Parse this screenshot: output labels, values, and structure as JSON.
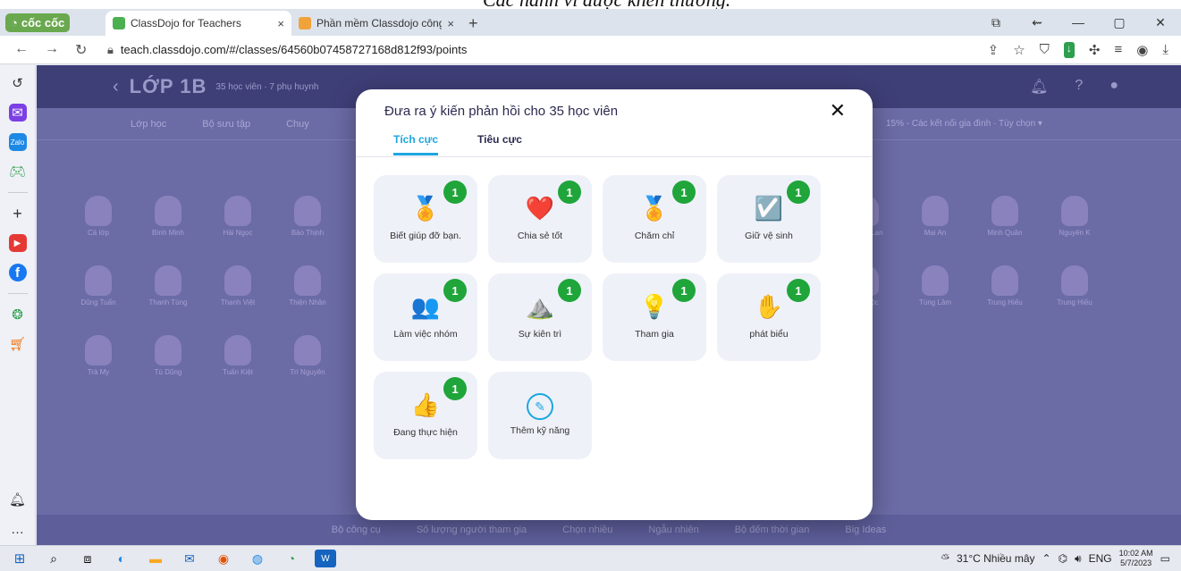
{
  "doc_caption": "Các hành vi được khen thưởng.",
  "browser": {
    "brand": "cốc cốc",
    "tabs": [
      {
        "title": "ClassDojo for Teachers",
        "close": "×"
      },
      {
        "title": "Phần mềm Classdojo công c",
        "close": "×"
      }
    ],
    "new_tab": "+",
    "url": "teach.classdojo.com/#/classes/64560b07458727168d812f93/points"
  },
  "app": {
    "class_name": "LỚP 1B",
    "class_sub": "35 học viên · 7 phụ huynh",
    "nav": [
      "Lớp học",
      "Bộ sưu tập",
      "Chuy"
    ],
    "nav_right": "15% - Các kết nối gia đình · Tùy chọn ▾",
    "students": [
      "Cả lớp",
      "Bình Minh",
      "Hải Ngọc",
      "Bảo Thịnh",
      "",
      "",
      "",
      "",
      "",
      "",
      "",
      "Hoàng Lan",
      "Mai An",
      "Minh Quân",
      "Nguyên K",
      "Dũng Tuấn",
      "Thanh Tùng",
      "Thanh Việt",
      "Thiện Nhân",
      "",
      "",
      "",
      "",
      "",
      "",
      "",
      "Bảo Lộc",
      "Tùng Lâm",
      "Trung Hiếu",
      "Trung Hiếu",
      "Trà My",
      "Tú Dũng",
      "Tuấn Kiệt",
      "Trí Nguyên"
    ],
    "footer": [
      "Bộ công cụ",
      "Số lượng người tham gia",
      "Chọn nhiều",
      "Ngẫu nhiên",
      "Bộ đếm thời gian",
      "Big Ideas"
    ]
  },
  "modal": {
    "title": "Đưa ra ý kiến phản hồi cho 35 học viên",
    "tabs": [
      "Tích cực",
      "Tiêu cực"
    ],
    "skills": [
      {
        "label": "Biết giúp đỡ bạn.",
        "icon": "🏅",
        "count": "1"
      },
      {
        "label": "Chia sẻ tốt",
        "icon": "❤️",
        "count": "1"
      },
      {
        "label": "Chăm chỉ",
        "icon": "🏅",
        "count": "1"
      },
      {
        "label": "Giữ vệ sinh",
        "icon": "☑️",
        "count": "1"
      },
      {
        "label": "Làm việc nhóm",
        "icon": "👥",
        "count": "1"
      },
      {
        "label": "Sự kiên trì",
        "icon": "⛰️",
        "count": "1"
      },
      {
        "label": "Tham gia",
        "icon": "💡",
        "count": "1"
      },
      {
        "label": "phát biểu",
        "icon": "✋",
        "count": "1"
      },
      {
        "label": "Đang thực hiện",
        "icon": "👍",
        "count": "1"
      }
    ],
    "add_skill": "Thêm kỹ năng"
  },
  "taskbar": {
    "weather": "31°C Nhiều mây",
    "lang": "ENG",
    "time": "10:02 AM",
    "date": "5/7/2023"
  }
}
